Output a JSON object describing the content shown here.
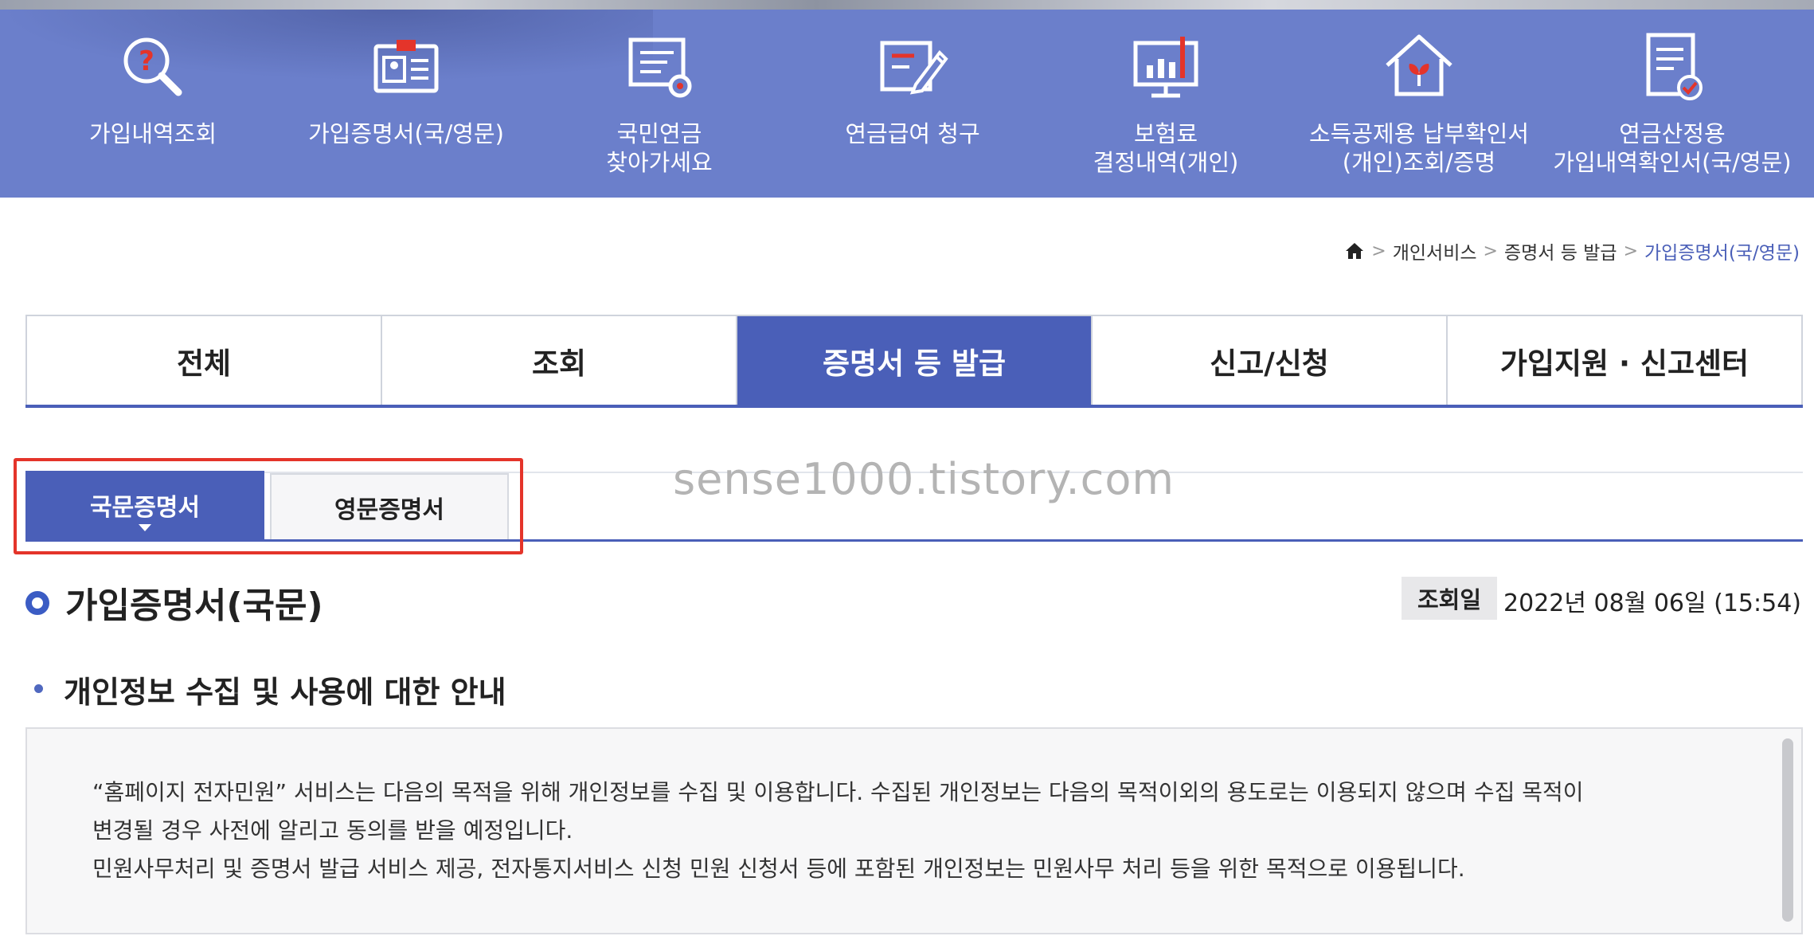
{
  "quick_menu": {
    "items": [
      {
        "label1": "가입내역조회",
        "label2": "",
        "icon": "magnifier-question-icon"
      },
      {
        "label1": "가입증명서(국/영문)",
        "label2": "",
        "icon": "id-card-icon"
      },
      {
        "label1": "국민연금",
        "label2": "찾아가세요",
        "icon": "document-search-icon"
      },
      {
        "label1": "연금급여 청구",
        "label2": "",
        "icon": "form-pencil-icon"
      },
      {
        "label1": "보험료",
        "label2": "결정내역(개인)",
        "icon": "monitor-chart-icon"
      },
      {
        "label1": "소득공제용 납부확인서",
        "label2": "(개인)조회/증명",
        "icon": "house-sprout-icon"
      },
      {
        "label1": "연금산정용",
        "label2": "가입내역확인서(국/영문)",
        "icon": "document-check-icon"
      }
    ]
  },
  "breadcrumb": {
    "items": [
      "개인서비스",
      "증명서 등 발급"
    ],
    "current": "가입증명서(국/영문)"
  },
  "main_tabs": [
    {
      "label": "전체"
    },
    {
      "label": "조회"
    },
    {
      "label": "증명서 등 발급"
    },
    {
      "label": "신고/신청"
    },
    {
      "label": "가입지원 · 신고센터"
    }
  ],
  "main_tabs_active": "증명서 등 발급",
  "sub_tabs": {
    "active": "국문증명서",
    "inactive": "영문증명서"
  },
  "watermark": "sense1000.tistory.com",
  "title": "가입증명서(국문)",
  "query": {
    "badge": "조회일",
    "date": "2022년 08월 06일 (15:54)"
  },
  "section": {
    "title": "개인정보 수집 및 사용에 대한 안내",
    "lines": [
      "“홈페이지 전자민원” 서비스는 다음의 목적을 위해 개인정보를 수집 및 이용합니다. 수집된 개인정보는 다음의 목적이외의 용도로는 이용되지 않으며 수집 목적이",
      "변경될 경우 사전에 알리고 동의를 받을 예정입니다.",
      "민원사무처리 및 증명서 발급 서비스 제공, 전자통지서비스 신청 민원 신청서 등에 포함된 개인정보는 민원사무 처리 등을 위한 목적으로 이용됩니다."
    ]
  },
  "colors": {
    "topbar": "#6b7fcb",
    "accent": "#4a5fb8",
    "highlight": "#e4342a"
  }
}
